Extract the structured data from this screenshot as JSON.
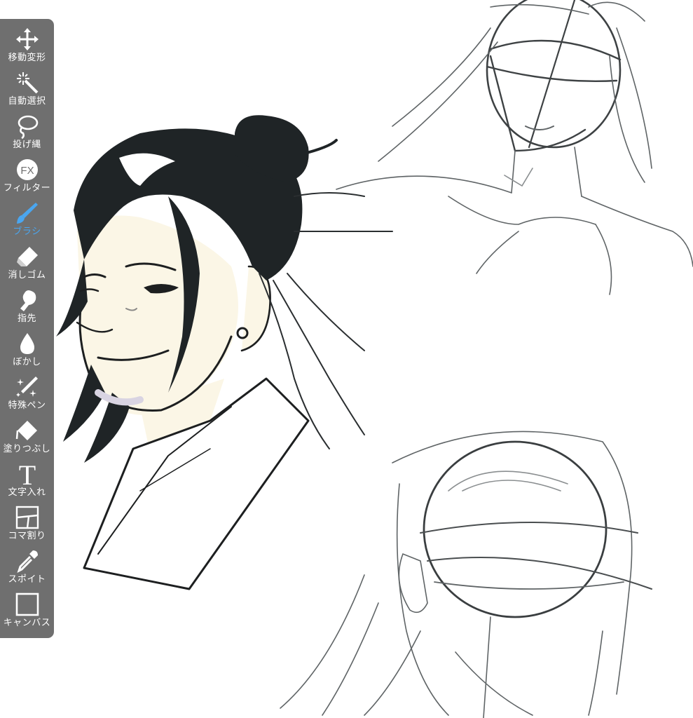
{
  "toolbar": {
    "active_tool": "brush",
    "active_color": "#4aa6f0",
    "tools": [
      {
        "id": "move",
        "label": "移動変形",
        "icon": "move-arrows-icon"
      },
      {
        "id": "magic",
        "label": "自動選択",
        "icon": "magic-wand-icon"
      },
      {
        "id": "lasso",
        "label": "投げ縄",
        "icon": "lasso-icon"
      },
      {
        "id": "filter",
        "label": "フィルター",
        "icon": "fx-filter-icon",
        "icon_text": "FX"
      },
      {
        "id": "brush",
        "label": "ブラシ",
        "icon": "brush-icon"
      },
      {
        "id": "eraser",
        "label": "消しゴム",
        "icon": "eraser-icon"
      },
      {
        "id": "finger",
        "label": "指先",
        "icon": "finger-smudge-icon"
      },
      {
        "id": "blur",
        "label": "ぼかし",
        "icon": "blur-drop-icon"
      },
      {
        "id": "special",
        "label": "特殊ペン",
        "icon": "sparkle-pen-icon"
      },
      {
        "id": "fill",
        "label": "塗りつぶし",
        "icon": "paint-bucket-icon"
      },
      {
        "id": "text",
        "label": "文字入れ",
        "icon": "text-t-icon",
        "icon_text": "T"
      },
      {
        "id": "frame",
        "label": "コマ割り",
        "icon": "frame-divider-icon"
      },
      {
        "id": "eyedropper",
        "label": "スポイト",
        "icon": "eyedropper-icon"
      },
      {
        "id": "canvas",
        "label": "キャンバス",
        "icon": "canvas-square-icon"
      }
    ]
  }
}
